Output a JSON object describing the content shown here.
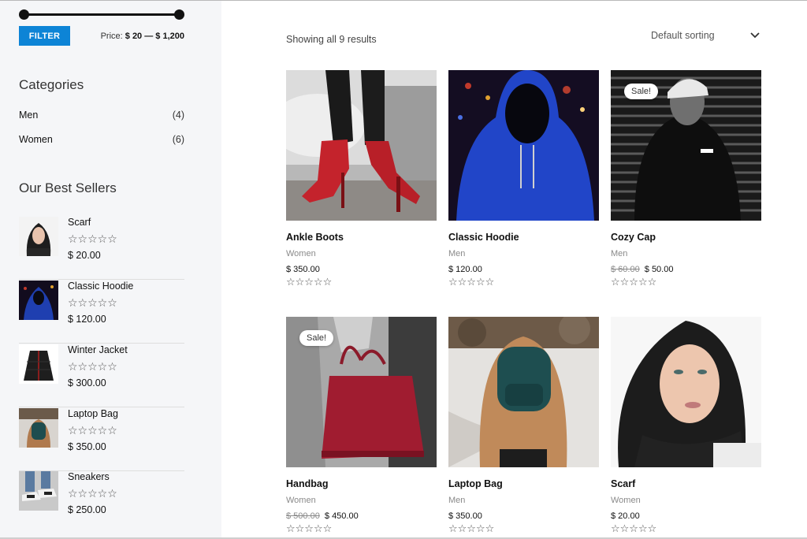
{
  "filter": {
    "button_label": "FILTER",
    "price_prefix": "Price:",
    "price_range": "$ 20 — $ 1,200"
  },
  "categories": {
    "title": "Categories",
    "items": [
      {
        "label": "Men",
        "count": "(4)"
      },
      {
        "label": "Women",
        "count": "(6)"
      }
    ]
  },
  "best_sellers": {
    "title": "Our Best Sellers",
    "items": [
      {
        "name": "Scarf",
        "price": "$ 20.00",
        "rating": "☆☆☆☆☆"
      },
      {
        "name": "Classic Hoodie",
        "price": "$ 120.00",
        "rating": "☆☆☆☆☆"
      },
      {
        "name": "Winter Jacket",
        "price": "$ 300.00",
        "rating": "☆☆☆☆☆"
      },
      {
        "name": "Laptop Bag",
        "price": "$ 350.00",
        "rating": "☆☆☆☆☆"
      },
      {
        "name": "Sneakers",
        "price": "$ 250.00",
        "rating": "☆☆☆☆☆"
      }
    ]
  },
  "shop": {
    "results_text": "Showing all 9 results",
    "sort_label": "Default sorting",
    "sale_badge": "Sale!",
    "products": [
      {
        "title": "Ankle Boots",
        "category": "Women",
        "old_price": "",
        "price": "$ 350.00",
        "rating": "☆☆☆☆☆",
        "sale": false
      },
      {
        "title": "Classic Hoodie",
        "category": "Men",
        "old_price": "",
        "price": "$ 120.00",
        "rating": "☆☆☆☆☆",
        "sale": false
      },
      {
        "title": "Cozy Cap",
        "category": "Men",
        "old_price": "$ 60.00",
        "price": "$ 50.00",
        "rating": "☆☆☆☆☆",
        "sale": true
      },
      {
        "title": "Handbag",
        "category": "Women",
        "old_price": "$ 500.00",
        "price": "$ 450.00",
        "rating": "☆☆☆☆☆",
        "sale": true
      },
      {
        "title": "Laptop Bag",
        "category": "Men",
        "old_price": "",
        "price": "$ 350.00",
        "rating": "☆☆☆☆☆",
        "sale": false
      },
      {
        "title": "Scarf",
        "category": "Women",
        "old_price": "",
        "price": "$ 20.00",
        "rating": "☆☆☆☆☆",
        "sale": false
      }
    ]
  },
  "icons": {
    "sort_chevron": "chevron-down-icon",
    "rating": "star-outline-icon"
  },
  "colors": {
    "accent": "#0d84d6",
    "sidebar_bg": "#f5f6f8"
  }
}
